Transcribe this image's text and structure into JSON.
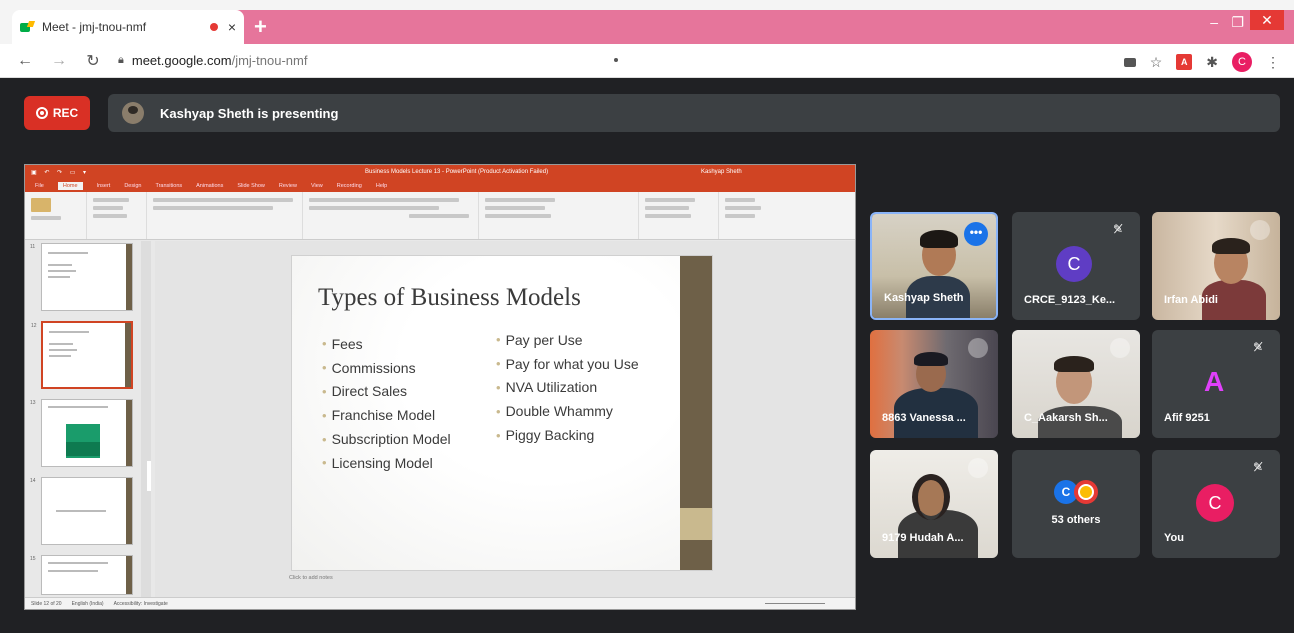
{
  "browser": {
    "tab_title": "Meet - jmj-tnou-nmf",
    "tab_close": "×",
    "new_tab": "+",
    "url_host": "meet.google.com",
    "url_path": "/jmj-tnou-nmf",
    "minimize": "‒",
    "maximize": "❐",
    "close": "✕",
    "profile_initial": "C",
    "pdf_label": "A"
  },
  "meet": {
    "rec_label": "REC",
    "presenting_text": "Kashyap Sheth is presenting",
    "others_count_label": "53 others"
  },
  "ppt": {
    "title_doc": "Business Models Lecture 13 - PowerPoint (Product Activation Failed)",
    "title_user": "Kashyap Sheth",
    "tabs": [
      "File",
      "Home",
      "Insert",
      "Design",
      "Transitions",
      "Animations",
      "Slide Show",
      "Review",
      "View",
      "Recording",
      "Help"
    ],
    "notes_placeholder": "Click to add notes",
    "status_left": "Slide 12 of 20",
    "status_lang": "English (India)",
    "status_access": "Accessibility: Investigate",
    "slide": {
      "title": "Types of Business Models",
      "left_items": [
        "Fees",
        "Commissions",
        "Direct Sales",
        "Franchise Model",
        "Subscription Model",
        "Licensing Model"
      ],
      "right_items": [
        "Pay per Use",
        "Pay for what you Use",
        "NVA Utilization",
        "Double Whammy",
        "Piggy Backing"
      ]
    },
    "thumb_numbers": [
      "11",
      "12",
      "13",
      "14",
      "15"
    ]
  },
  "tiles": [
    {
      "name": "Kashyap Sheth"
    },
    {
      "name": "CRCE_9123_Ke...",
      "initial": "C",
      "color": "#5f3dc4"
    },
    {
      "name": "Irfan Abidi"
    },
    {
      "name": "8863 Vanessa ..."
    },
    {
      "name": "C_Aakarsh Sh..."
    },
    {
      "name": "Afif 9251",
      "initial": "A",
      "color": "#e040fb"
    },
    {
      "name": "9179 Hudah A..."
    },
    {
      "name": "53 others",
      "initial": "C"
    },
    {
      "name": "You",
      "initial": "C",
      "color": "#e91e63"
    }
  ]
}
